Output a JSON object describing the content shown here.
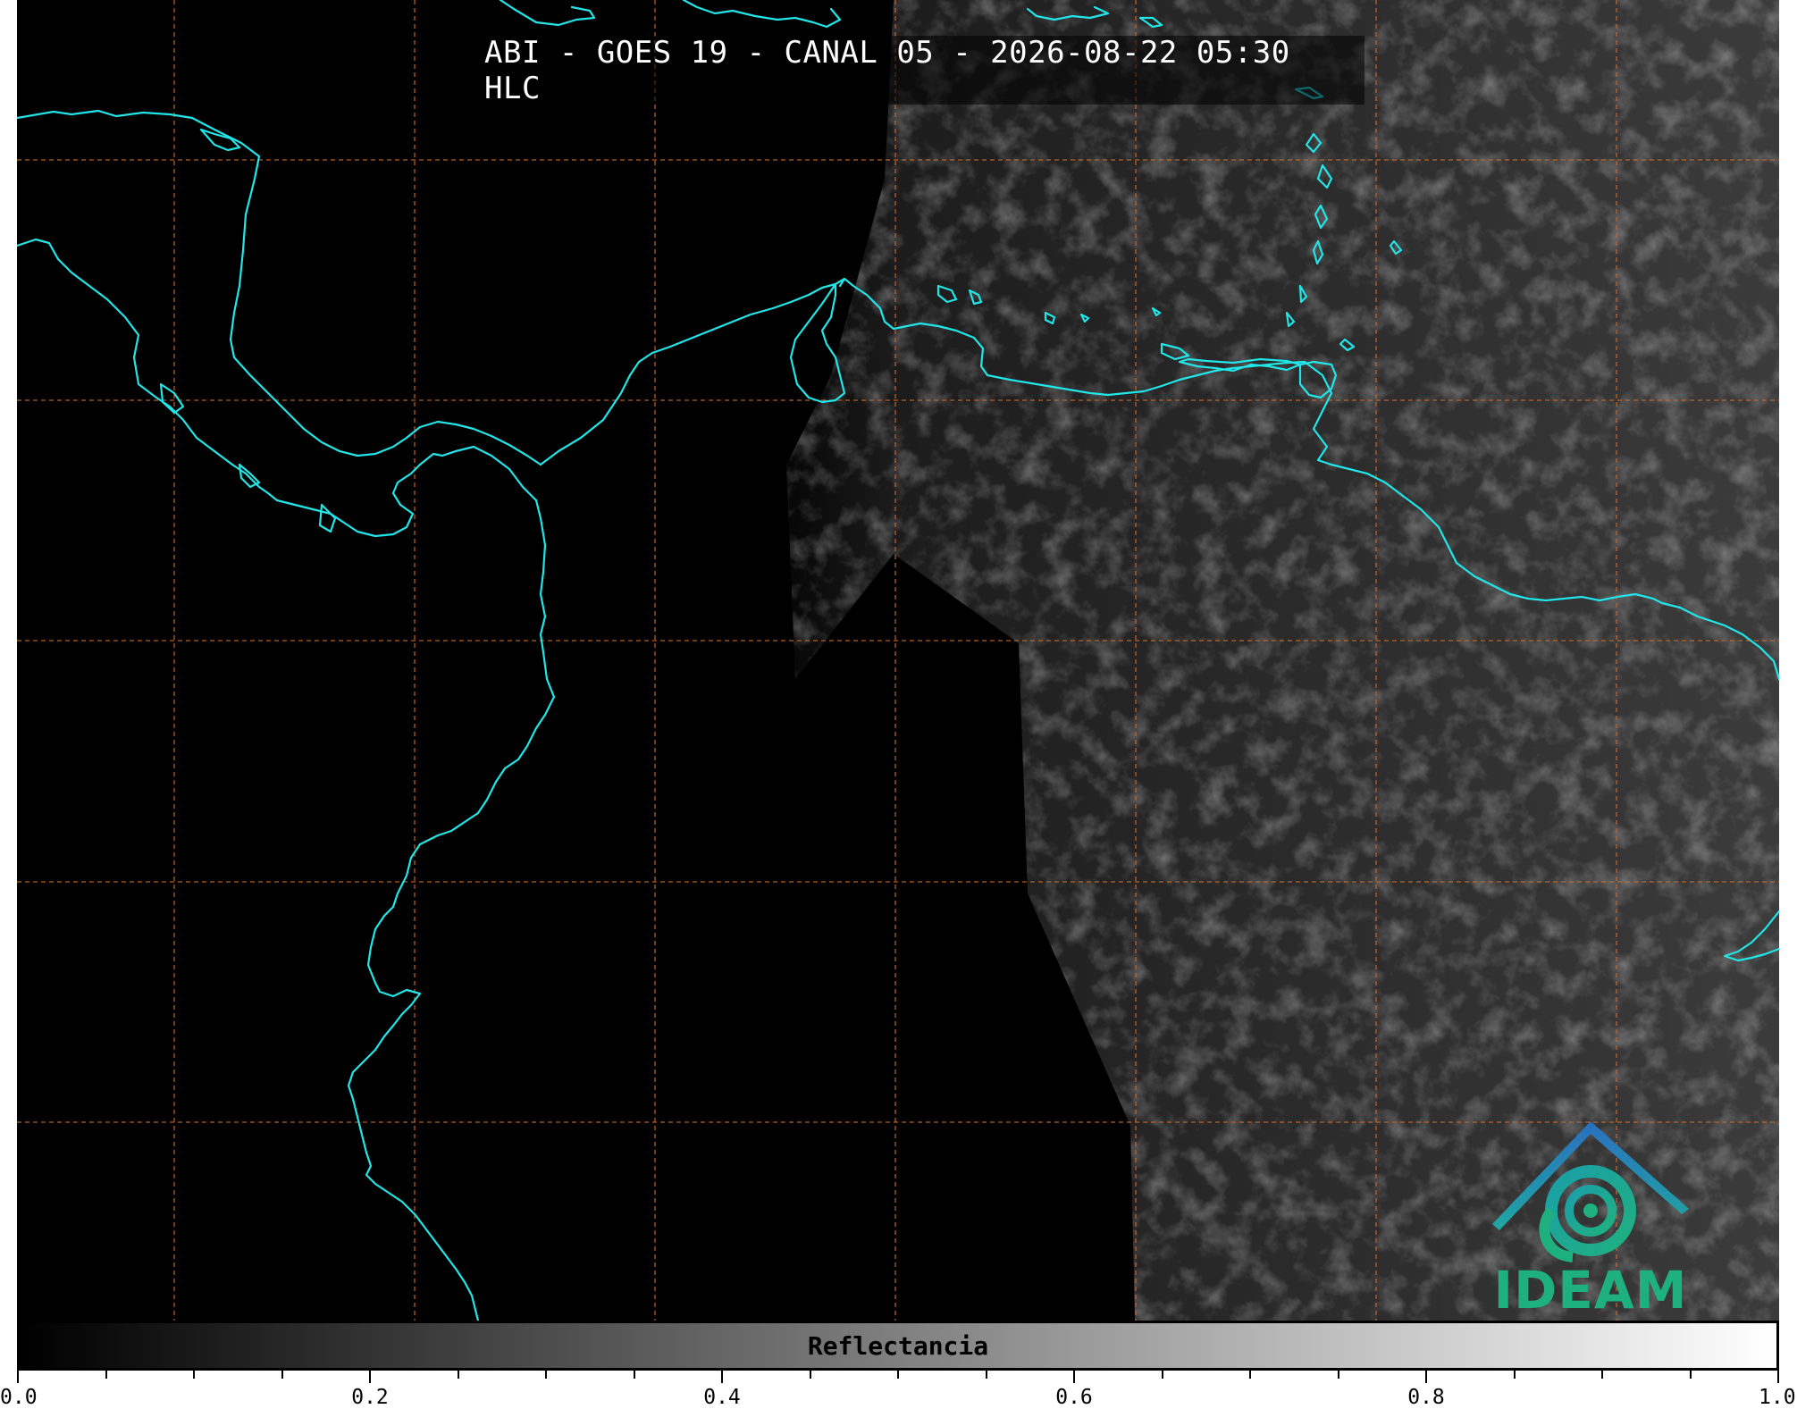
{
  "title": "ABI - GOES 19 - CANAL 05 - 2026-08-22 05:30 HLC",
  "colorbar": {
    "label": "Reflectancia",
    "tick_labels": [
      "0.0",
      "0.2",
      "0.4",
      "0.6",
      "0.8",
      "1.0"
    ],
    "range": [
      0.0,
      1.0
    ],
    "cmap_start": "#000000",
    "cmap_end": "#ffffff"
  },
  "logo": {
    "text": "IDEAM",
    "color": "#1fb07f",
    "roof_color": "#2a6fc0"
  },
  "map": {
    "coastline_color": "#22e5e8",
    "gridline_color": "#c8682a",
    "background": "#000000"
  }
}
